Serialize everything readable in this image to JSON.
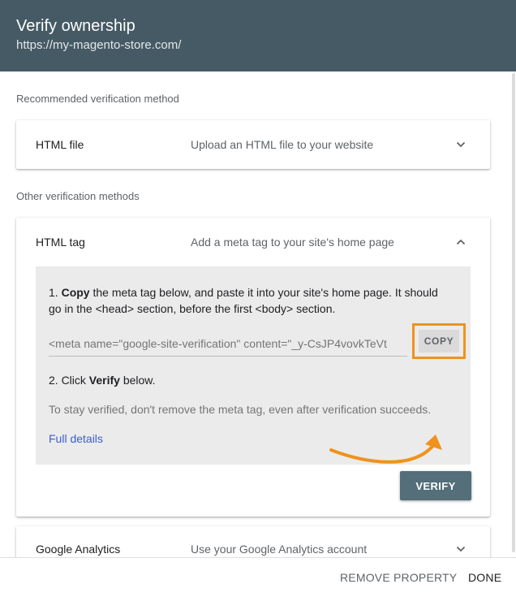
{
  "header": {
    "title": "Verify ownership",
    "url": "https://my-magento-store.com/"
  },
  "recommended": {
    "label": "Recommended verification method",
    "method": {
      "name": "HTML file",
      "description": "Upload an HTML file to your website",
      "expanded": false
    }
  },
  "other": {
    "label": "Other verification methods",
    "html_tag": {
      "name": "HTML tag",
      "description": "Add a meta tag to your site's home page",
      "expanded": true,
      "step1_prefix": "1. ",
      "step1_bold": "Copy",
      "step1_mid": " the meta tag below, and paste it into your site's home page. It should go in the ",
      "step1_code1": "<head>",
      "step1_mid2": " section, before the first ",
      "step1_code2": "<body>",
      "step1_suffix": " section.",
      "meta_tag": "<meta name=\"google-site-verification\" content=\"_y-CsJP4vovkTeVt",
      "copy_label": "COPY",
      "step2_prefix": "2. Click ",
      "step2_bold": "Verify",
      "step2_suffix": " below.",
      "note": "To stay verified, don't remove the meta tag, even after verification succeeds.",
      "details_link": "Full details",
      "verify_label": "VERIFY"
    },
    "google_analytics": {
      "name": "Google Analytics",
      "description": "Use your Google Analytics account",
      "expanded": false
    }
  },
  "footer": {
    "remove_label": "REMOVE PROPERTY",
    "done_label": "DONE"
  },
  "annotation": {
    "highlight_color": "#f0921b",
    "icon": "curved-arrow-icon"
  },
  "colors": {
    "header_bg": "#455a64",
    "verify_button_bg": "#546e7a",
    "link": "#3c5ecb"
  }
}
